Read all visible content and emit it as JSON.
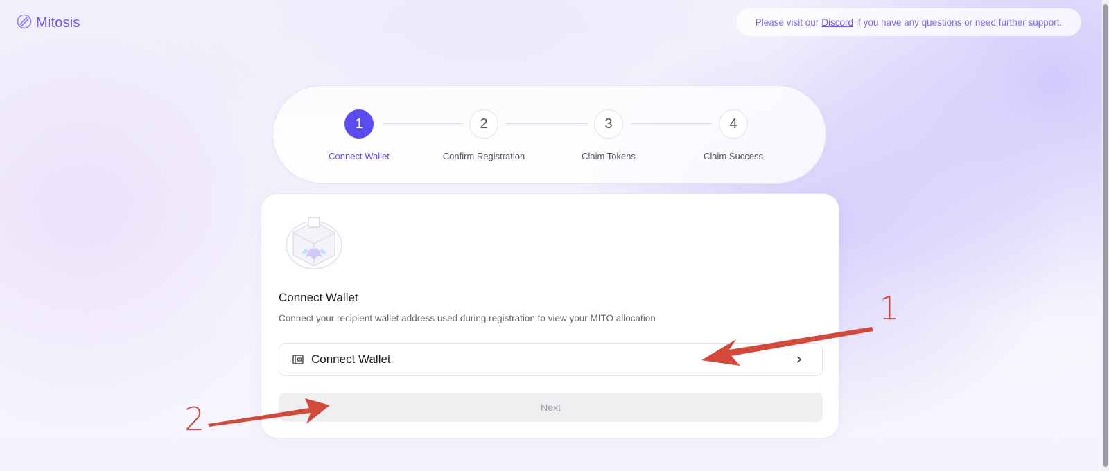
{
  "brand": {
    "name": "Mitosis",
    "color": "#6a5bf0"
  },
  "support": {
    "prefix": "Please visit our",
    "link_label": "Discord",
    "suffix": "if you have any questions or need further support."
  },
  "stepper": {
    "steps": [
      {
        "number": "1",
        "label": "Connect Wallet",
        "active": true
      },
      {
        "number": "2",
        "label": "Confirm Registration",
        "active": false
      },
      {
        "number": "3",
        "label": "Claim Tokens",
        "active": false
      },
      {
        "number": "4",
        "label": "Claim Success",
        "active": false
      }
    ],
    "active_color": "#5b4cf0"
  },
  "card": {
    "title": "Connect Wallet",
    "description": "Connect your recipient wallet address used during registration to view your MITO allocation",
    "connect_button": {
      "label": "Connect Wallet",
      "icon": "wallet-icon",
      "trailing_icon": "chevron-right-icon"
    },
    "next_button": {
      "label": "Next",
      "enabled": false
    }
  },
  "annotations": {
    "color": "#d34a3c",
    "markers": [
      {
        "number": "1",
        "points_to": "connect-wallet-button"
      },
      {
        "number": "2",
        "points_to": "next-button"
      }
    ]
  }
}
